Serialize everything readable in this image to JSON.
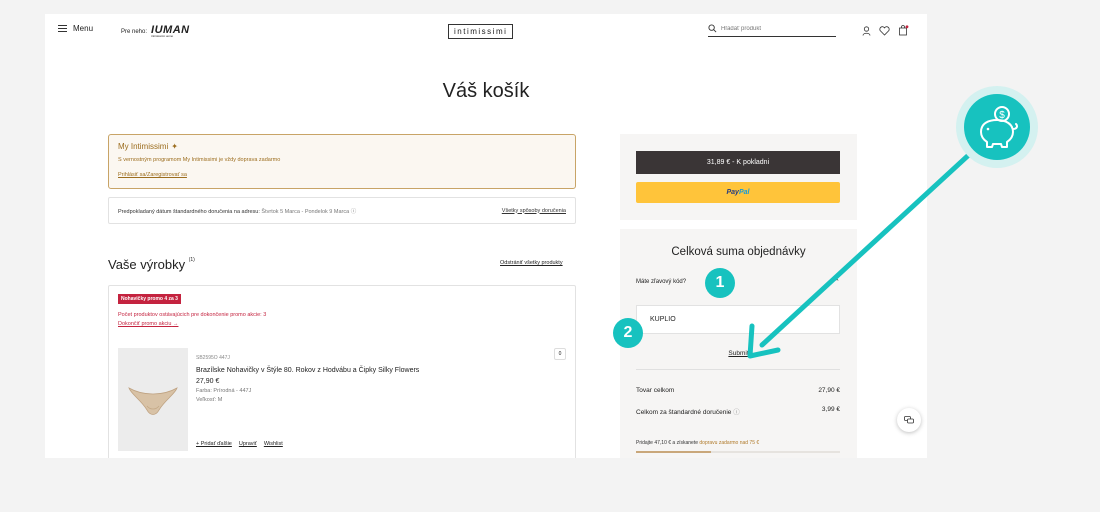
{
  "header": {
    "menu_label": "Menu",
    "for_him_label": "Pre neho:",
    "uman_brand": "IUMAN",
    "uman_tagline": "intimissimi uomo",
    "logo_text": "intimissimi",
    "search_placeholder": "Hľadať produkt"
  },
  "page_title": "Váš košík",
  "loyalty": {
    "title": "My Intimissimi",
    "text": "S vernostným programom My Intimissimi je vždy doprava zadarmo",
    "link": "Prihlásiť sa/Zaregistrovať sa"
  },
  "delivery": {
    "label": "Predpokladaný dátum štandardného doručenia na adresu:",
    "dates": "Štvrtok 5 Marca - Pondelok 9 Marca",
    "link": "Všetky spôsoby doručenia"
  },
  "products": {
    "heading": "Vaše výrobky",
    "count": "(1)",
    "remove_all": "Odstrániť všetky produkty",
    "promo_badge": "Nohavičky promo 4 za 3",
    "promo_text": "Počet produktov ostávajúcich pre dokončenie promo akcie: 3",
    "promo_link": "Dokončiť promo akciu",
    "items": [
      {
        "code": "SB2595O 447J",
        "name": "Brazílske Nohavičky v Štýle 80. Rokov z Hodvábu a Čipky Silky Flowers",
        "price": "27,90 €",
        "color": "Farba: Prírodná - 447J",
        "size": "Veľkosť: M",
        "qty": "0",
        "add_label": "+ Pridať ďalšie",
        "edit_label": "Upraviť",
        "wishlist_label": "Wishlist"
      }
    ]
  },
  "checkout": {
    "button_label": "31,89 € - K pokladni",
    "paypal_pay": "Pay",
    "paypal_pal": "Pal"
  },
  "summary": {
    "title": "Celková suma objednávky",
    "coupon_question": "Máte zľavový kód?",
    "coupon_value": "KUPLIO",
    "submit_label": "Submit",
    "subtotal_label": "Tovar celkom",
    "subtotal_value": "27,90 €",
    "shipping_label": "Celkom za štandardné doručenie",
    "shipping_value": "3,99 €",
    "free_ship_note_a": "Pridajte 47,10 € a získanete",
    "free_ship_note_b": "dopravu zadarmo nad 75 €",
    "free_ship_progress": 0.37
  },
  "callouts": {
    "step1": "1",
    "step2": "2",
    "accent_color": "#17c2bf"
  }
}
